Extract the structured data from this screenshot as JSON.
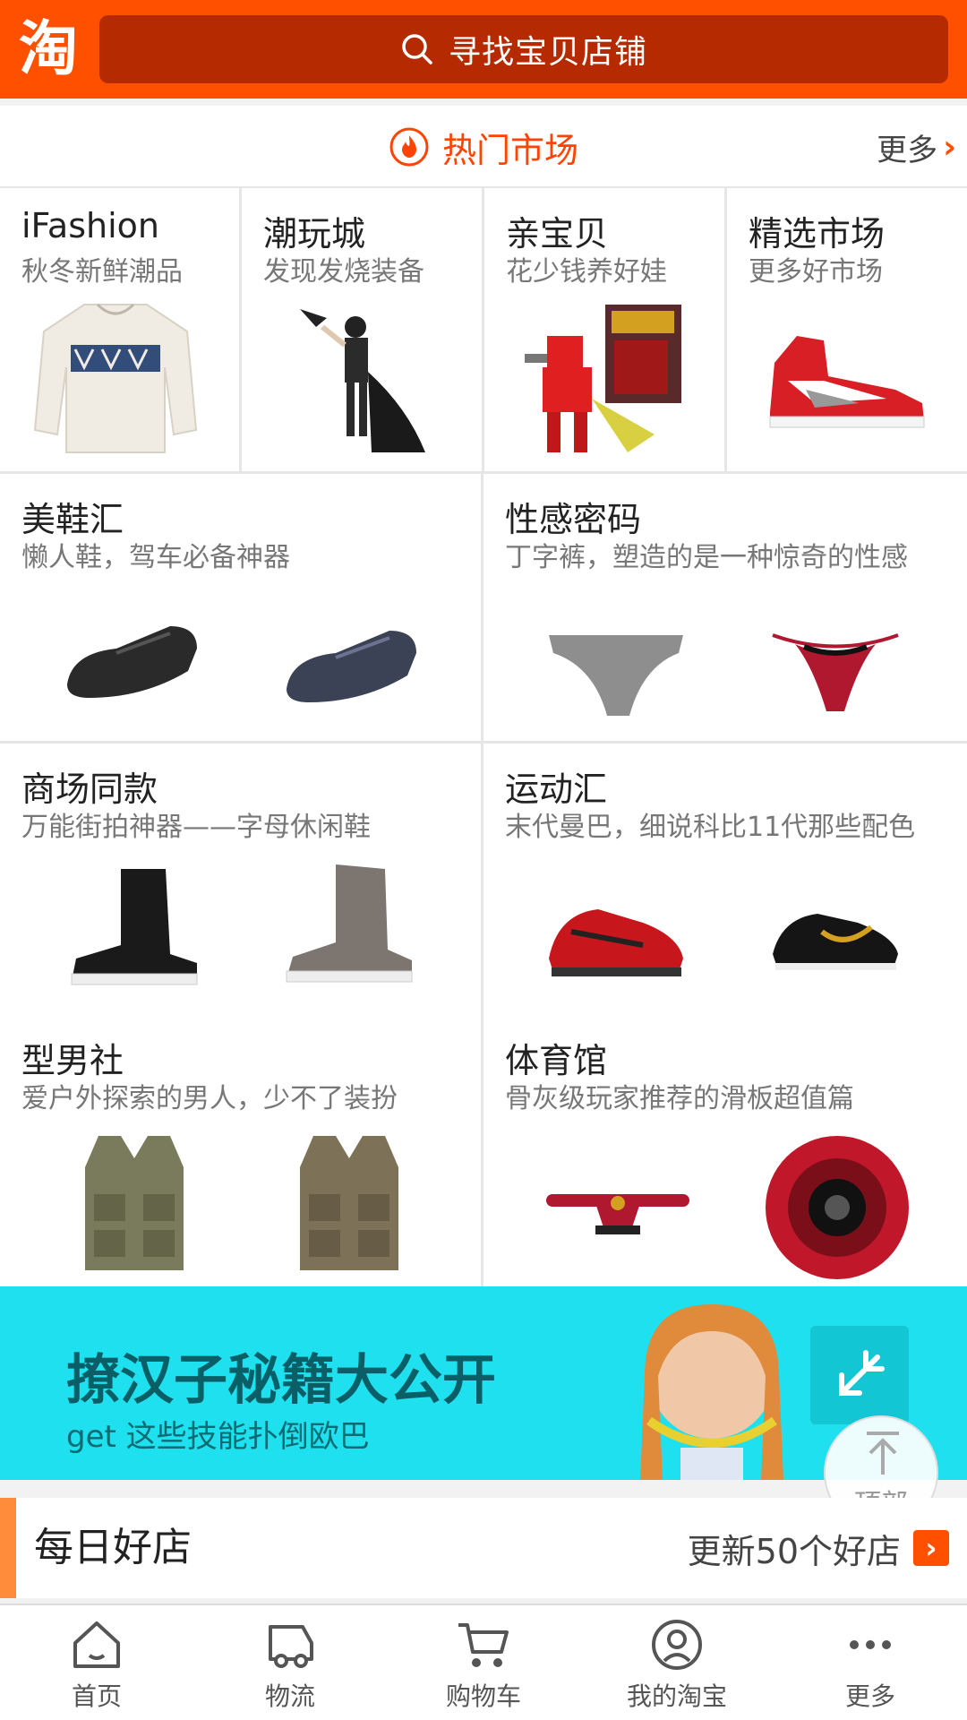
{
  "header": {
    "logo_text": "淘",
    "search_placeholder": "寻找宝贝店铺",
    "color": "#ff5000"
  },
  "hot_markets": {
    "title": "热门市场",
    "more": "更多",
    "icon": "fire-icon"
  },
  "markets_row1": [
    {
      "title": "iFashion",
      "subtitle": "秋冬新鲜潮品",
      "image": "sweater"
    },
    {
      "title": "潮玩城",
      "subtitle": "发现发烧装备",
      "image": "figure"
    },
    {
      "title": "亲宝贝",
      "subtitle": "花少钱养好娃",
      "image": "toy-robot"
    },
    {
      "title": "精选市场",
      "subtitle": "更多好市场",
      "image": "sneaker"
    }
  ],
  "markets_rows": [
    {
      "title": "美鞋汇",
      "subtitle": "懒人鞋，驾车必备神器"
    },
    {
      "title": "性感密码",
      "subtitle": "丁字裤，塑造的是一种惊奇的性感"
    },
    {
      "title": "商场同款",
      "subtitle": "万能街拍神器——字母休闲鞋"
    },
    {
      "title": "运动汇",
      "subtitle": "末代曼巴，细说科比11代那些配色"
    },
    {
      "title": "型男社",
      "subtitle": "爱户外探索的男人，少不了装扮"
    },
    {
      "title": "体育馆",
      "subtitle": "骨灰级玩家推荐的滑板超值篇"
    }
  ],
  "banner": {
    "title": "撩汉子秘籍大公开",
    "subtitle": "get 这些技能扑倒欧巴",
    "color": "#1ee0ee"
  },
  "to_top": {
    "label": "顶部"
  },
  "daily_shops": {
    "title": "每日好店",
    "right_text": "更新50个好店"
  },
  "tabbar": [
    {
      "label": "首页",
      "icon": "home-icon"
    },
    {
      "label": "物流",
      "icon": "truck-icon"
    },
    {
      "label": "购物车",
      "icon": "cart-icon"
    },
    {
      "label": "我的淘宝",
      "icon": "profile-icon"
    },
    {
      "label": "更多",
      "icon": "more-icon"
    }
  ]
}
